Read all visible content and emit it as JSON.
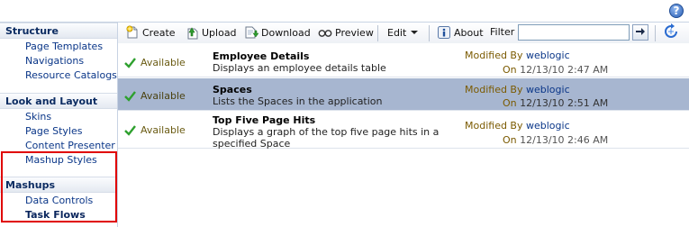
{
  "help": {
    "label": "?"
  },
  "sidebar": {
    "sections": [
      {
        "title": "Structure",
        "items": [
          "Page Templates",
          "Navigations",
          "Resource Catalogs"
        ]
      },
      {
        "title": "Look and Layout",
        "items": [
          "Skins",
          "Page Styles",
          "Content Presenter",
          "Mashup Styles"
        ]
      },
      {
        "title": "Mashups",
        "items": [
          "Data Controls",
          "Task Flows"
        ]
      }
    ],
    "active_item": "Task Flows"
  },
  "toolbar": {
    "create": "Create",
    "upload": "Upload",
    "download": "Download",
    "preview": "Preview",
    "edit": "Edit",
    "about": "About",
    "filter_label": "Filter",
    "filter_value": ""
  },
  "resources": [
    {
      "status": "Available",
      "title": "Employee Details",
      "description": "Displays an employee details table",
      "modified_by_label": "Modified By",
      "modified_by": "weblogic",
      "on_label": "On",
      "date": "12/13/10 2:47 AM",
      "selected": false
    },
    {
      "status": "Available",
      "title": "Spaces",
      "description": "Lists the Spaces in the application",
      "modified_by_label": "Modified By",
      "modified_by": "weblogic",
      "on_label": "On",
      "date": "12/13/10 2:51 AM",
      "selected": true
    },
    {
      "status": "Available",
      "title": "Top Five Page Hits",
      "description": "Displays a graph of the top five page hits in a specified Space",
      "modified_by_label": "Modified By",
      "modified_by": "weblogic",
      "on_label": "On",
      "date": "12/13/10 2:46 AM",
      "selected": false
    }
  ],
  "colors": {
    "selected_row": "#a7b6d0",
    "highlight_box": "#e00000",
    "link": "#0a3688",
    "status_text": "#6b5c14"
  }
}
